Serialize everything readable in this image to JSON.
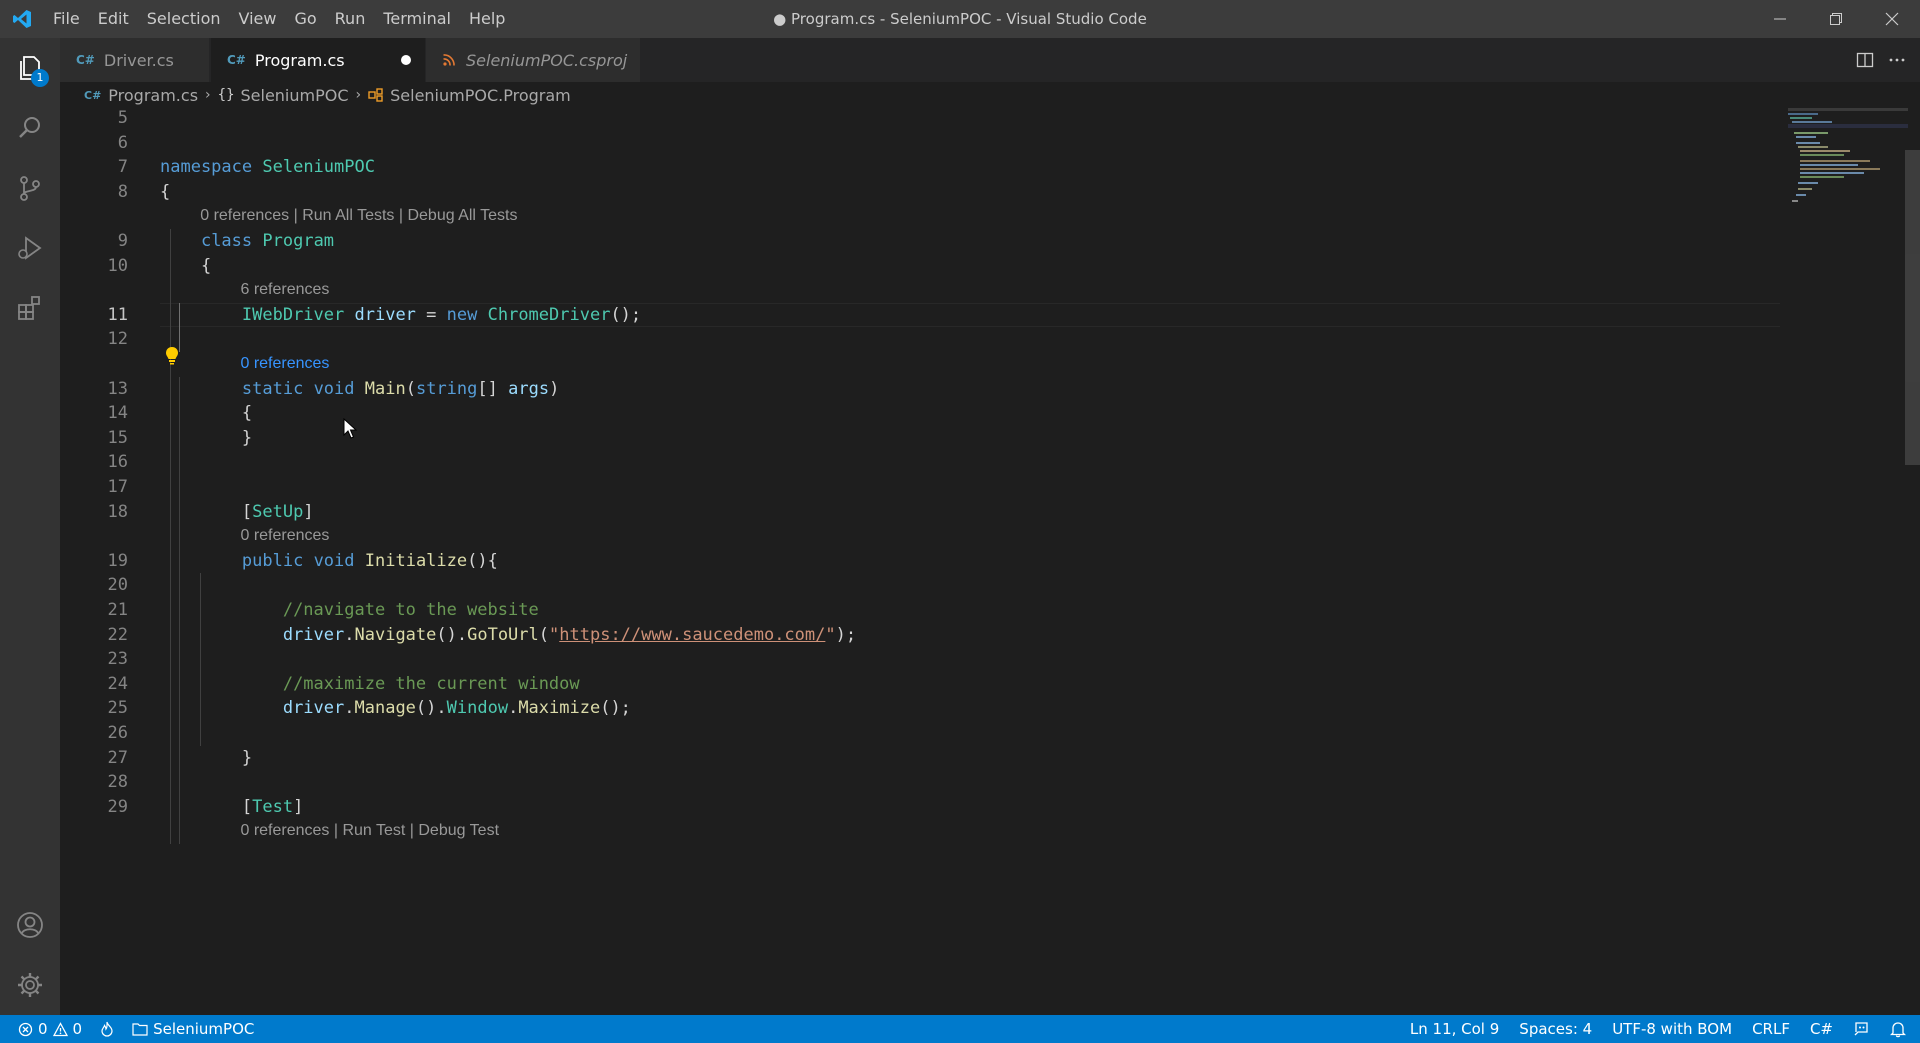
{
  "app": {
    "window_title": "● Program.cs - SeleniumPOC - Visual Studio Code",
    "menu": [
      "File",
      "Edit",
      "Selection",
      "View",
      "Go",
      "Run",
      "Terminal",
      "Help"
    ]
  },
  "activity_bar": {
    "explorer_badge": "1",
    "items": [
      "explorer-icon",
      "search-icon",
      "source-control-icon",
      "run-debug-icon",
      "extensions-icon",
      "accounts-icon",
      "manage-gear-icon"
    ]
  },
  "tabs": [
    {
      "label": "Driver.cs",
      "icon": "C#",
      "active": false,
      "dirty": false,
      "italic": false
    },
    {
      "label": "Program.cs",
      "icon": "C#",
      "active": true,
      "dirty": true,
      "italic": false
    },
    {
      "label": "SeleniumPOC.csproj",
      "icon": "rss",
      "active": false,
      "dirty": false,
      "italic": true
    }
  ],
  "breadcrumb": {
    "file": "Program.cs",
    "namespace": "SeleniumPOC",
    "class": "SeleniumPOC.Program"
  },
  "editor": {
    "active_line": "11",
    "lines": [
      {
        "n": "5",
        "code": ""
      },
      {
        "n": "6",
        "code": ""
      },
      {
        "n": "7",
        "code": "namespace SeleniumPOC"
      },
      {
        "n": "8",
        "code": "{"
      },
      {
        "lens": "0 references | Run All Tests | Debug All Tests"
      },
      {
        "n": "9",
        "code": "    class Program"
      },
      {
        "n": "10",
        "code": "    {"
      },
      {
        "lens": "6 references"
      },
      {
        "n": "11",
        "code": "        IWebDriver driver = new ChromeDriver();"
      },
      {
        "n": "12",
        "code": ""
      },
      {
        "lens": "0 references"
      },
      {
        "n": "13",
        "code": "        static void Main(string[] args)"
      },
      {
        "n": "14",
        "code": "        {"
      },
      {
        "n": "15",
        "code": "        }"
      },
      {
        "n": "16",
        "code": ""
      },
      {
        "n": "17",
        "code": ""
      },
      {
        "n": "18",
        "code": "        [SetUp]"
      },
      {
        "lens": "0 references"
      },
      {
        "n": "19",
        "code": "        public void Initialize(){"
      },
      {
        "n": "20",
        "code": ""
      },
      {
        "n": "21",
        "code": "            //navigate to the website"
      },
      {
        "n": "22",
        "code": "            driver.Navigate().GoToUrl(\"https://www.saucedemo.com/\");"
      },
      {
        "n": "23",
        "code": ""
      },
      {
        "n": "24",
        "code": "            //maximize the current window"
      },
      {
        "n": "25",
        "code": "            driver.Manage().Window.Maximize();"
      },
      {
        "n": "26",
        "code": ""
      },
      {
        "n": "27",
        "code": "        }"
      },
      {
        "n": "28",
        "code": ""
      },
      {
        "n": "29",
        "code": "        [Test]"
      },
      {
        "lens": "0 references | Run Test | Debug Test"
      }
    ]
  },
  "statusbar": {
    "errors": "0",
    "warnings": "0",
    "project": "SeleniumPOC",
    "cursor_position": "Ln 11, Col 9",
    "indent": "Spaces: 4",
    "encoding": "UTF-8 with BOM",
    "eol": "CRLF",
    "language": "C#"
  },
  "colors": {
    "accent": "#007acc",
    "keyword": "#569cd6",
    "type": "#4ec9b0",
    "function": "#dcdcaa",
    "variable": "#9cdcfe",
    "string": "#ce9178",
    "comment": "#6a9955"
  }
}
